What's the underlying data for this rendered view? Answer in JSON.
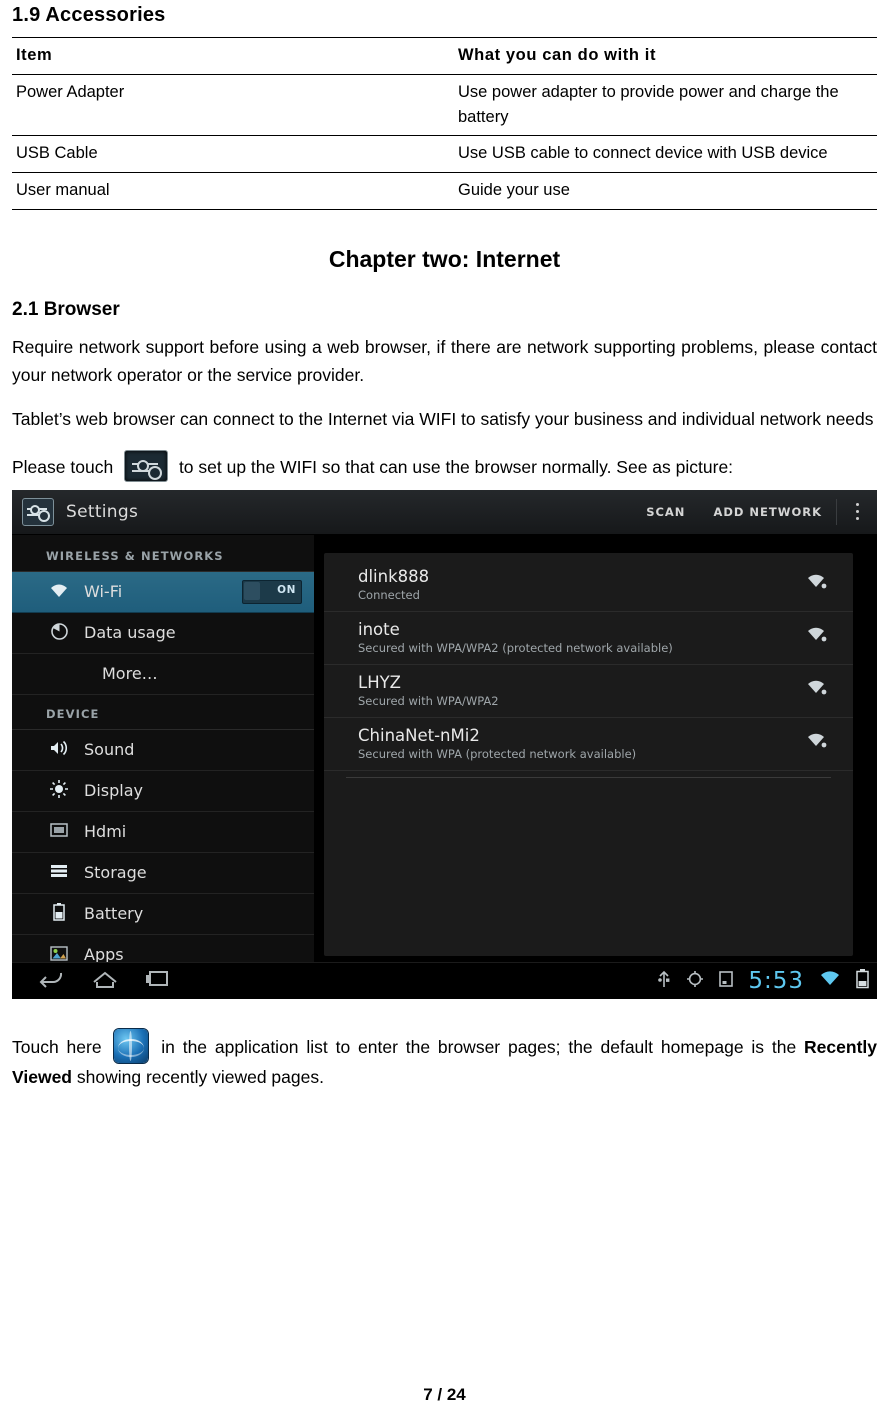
{
  "document": {
    "section_heading": "1.9 Accessories",
    "accessories_table": {
      "headers": [
        "Item",
        "What you can do with it"
      ],
      "rows": [
        [
          "Power Adapter",
          "Use power adapter to provide power and charge the battery"
        ],
        [
          "USB Cable",
          "Use USB cable to connect device with USB device"
        ],
        [
          "User manual",
          "Guide your use"
        ]
      ]
    },
    "chapter_title": "Chapter two: Internet",
    "browser_heading": "2.1 Browser",
    "paragraph_1": "Require network support before using a web browser, if there are network supporting problems, please contact your network operator or the service provider.",
    "paragraph_2": "Tablet’s web browser can connect to the Internet via WIFI to satisfy your business and individual network needs",
    "paragraph_3_before": "Please touch",
    "paragraph_3_after": "to set up the WIFI so that can use the browser normally. See as picture:",
    "paragraph_4_before": "Touch here",
    "paragraph_4_mid": "in the application list to enter the browser pages; the default homepage is the",
    "paragraph_4_bold": "Recently Viewed",
    "paragraph_4_after": "showing recently viewed pages.",
    "page_number": "7 / 24"
  },
  "screenshot": {
    "titlebar": {
      "app_icon": "settings-icon",
      "title": "Settings",
      "scan_label": "SCAN",
      "add_network_label": "ADD NETWORK",
      "overflow_label": "overflow-menu-icon"
    },
    "sidebar": {
      "group_wireless": "WIRELESS & NETWORKS",
      "group_device": "DEVICE",
      "items": [
        {
          "label": "Wi-Fi",
          "icon": "wifi-icon",
          "toggle": "ON",
          "selected": true
        },
        {
          "label": "Data usage",
          "icon": "data-usage-icon"
        },
        {
          "label": "More…",
          "icon": ""
        },
        {
          "label": "Sound",
          "icon": "sound-icon"
        },
        {
          "label": "Display",
          "icon": "display-icon"
        },
        {
          "label": "Hdmi",
          "icon": "hdmi-icon"
        },
        {
          "label": "Storage",
          "icon": "storage-icon"
        },
        {
          "label": "Battery",
          "icon": "battery-icon"
        },
        {
          "label": "Apps",
          "icon": "apps-icon"
        }
      ]
    },
    "wifi_list": [
      {
        "ssid": "dlink888",
        "status": "Connected",
        "signal": "wifi-signal-icon"
      },
      {
        "ssid": "inote",
        "status": "Secured with WPA/WPA2 (protected network available)",
        "signal": "wifi-signal-icon"
      },
      {
        "ssid": "LHYZ",
        "status": "Secured with WPA/WPA2",
        "signal": "wifi-signal-icon"
      },
      {
        "ssid": "ChinaNet-nMi2",
        "status": "Secured with WPA (protected network available)",
        "signal": "wifi-signal-icon"
      }
    ],
    "navbar": {
      "back": "back-icon",
      "home": "home-icon",
      "recents": "recents-icon",
      "usb": "usb-icon",
      "debug": "android-debug-icon",
      "screenshot": "screenshot-icon",
      "clock": "5:53",
      "wifi": "wifi-status-icon",
      "battery": "battery-status-icon"
    },
    "colors": {
      "accent_selected": "#2b6a86",
      "clock_blue": "#5ec8f0",
      "panel_bg": "#1b1b1b"
    }
  }
}
